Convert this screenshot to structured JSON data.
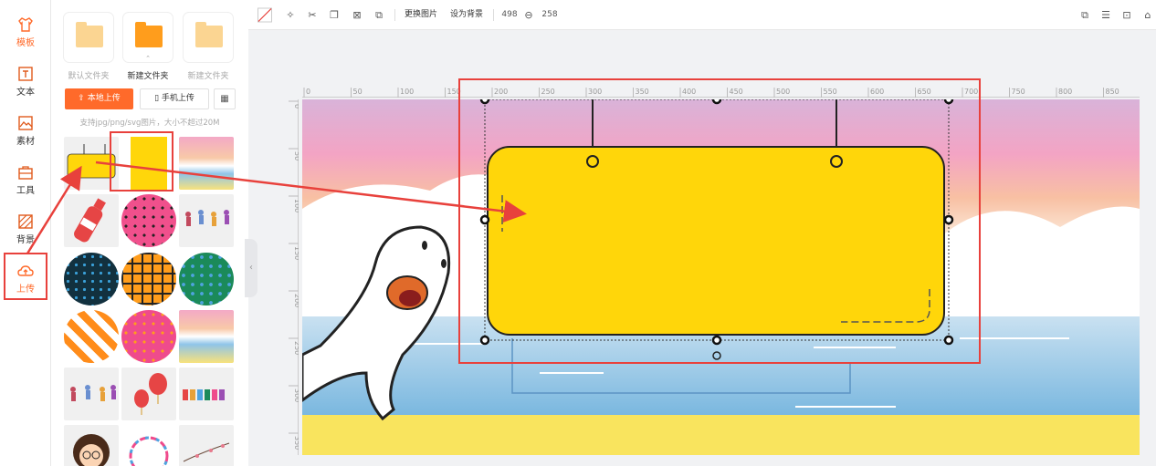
{
  "nav": {
    "items": [
      {
        "label": "模板",
        "icon": "shirt-icon"
      },
      {
        "label": "文本",
        "icon": "text-icon"
      },
      {
        "label": "素材",
        "icon": "material-icon"
      },
      {
        "label": "工具",
        "icon": "toolbox-icon"
      },
      {
        "label": "背景",
        "icon": "background-icon"
      },
      {
        "label": "上传",
        "icon": "upload-cloud-icon"
      }
    ],
    "active_label": "上传"
  },
  "panel": {
    "folders": [
      {
        "label": "默认文件夹"
      },
      {
        "label": "新建文件夹",
        "selected": true
      },
      {
        "label": "新建文件夹"
      }
    ],
    "upload_local_label": "本地上传",
    "upload_phone_label": "手机上传",
    "hint": "支持jpg/png/svg图片，大小不超过20M"
  },
  "toolbar": {
    "replace_label": "更换图片",
    "set_bg_label": "设为背景",
    "width_value": "498",
    "height_value": "258"
  },
  "rulers": {
    "top_ticks": [
      "0",
      "50",
      "100",
      "150",
      "200",
      "250",
      "300",
      "350",
      "400",
      "450",
      "500",
      "550",
      "600",
      "650",
      "700",
      "750",
      "800",
      "850"
    ],
    "left_ticks": [
      "0",
      "50",
      "100",
      "150",
      "200",
      "250",
      "300",
      "350"
    ]
  },
  "colors": {
    "accent": "#ff6a2a",
    "annotation_red": "#e8413c",
    "sign_yellow": "#ffd60a"
  }
}
